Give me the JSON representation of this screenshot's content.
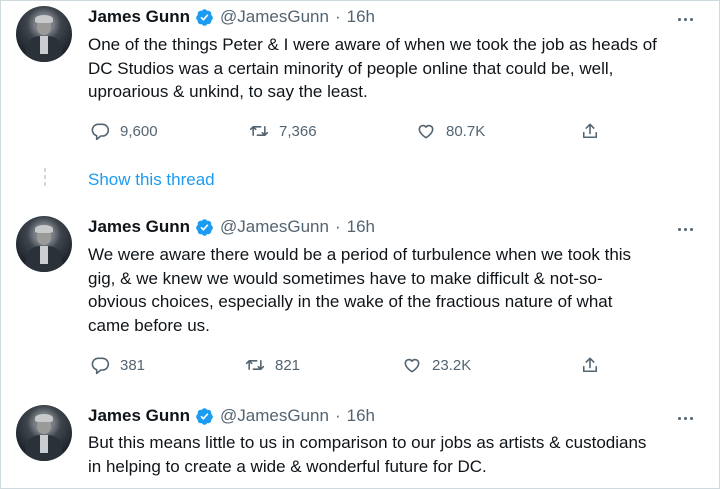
{
  "tweets": [
    {
      "name": "James Gunn",
      "handle": "@JamesGunn",
      "time": "16h",
      "separator": "·",
      "text": "One of the things Peter & I were aware of when we took the job as heads of\nDC Studios was a certain minority of people online that could be, well,\nuproarious & unkind, to say the least.",
      "replies": "9,600",
      "retweets": "7,366",
      "likes": "80.7K"
    },
    {
      "name": "James Gunn",
      "handle": "@JamesGunn",
      "time": "16h",
      "separator": "·",
      "text": "We were aware there would be a period of turbulence when we took this\ngig, & we knew we would sometimes have to make difficult & not-so-\nobvious choices, especially in the wake of the fractious nature of what\ncame before us.",
      "replies": "381",
      "retweets": "821",
      "likes": "23.2K"
    },
    {
      "name": "James Gunn",
      "handle": "@JamesGunn",
      "time": "16h",
      "separator": "·",
      "text": "But this means little to us in comparison to our jobs as artists & custodians\nin helping to create a wide & wonderful future for DC."
    }
  ],
  "show_thread": "Show this thread",
  "colors": {
    "accent": "#1d9bf0",
    "text": "#0f1419",
    "secondary": "#536471",
    "border": "#cfd9de"
  },
  "icons": [
    "verified-badge-icon",
    "more-icon",
    "reply-icon",
    "retweet-icon",
    "like-icon",
    "share-icon"
  ]
}
